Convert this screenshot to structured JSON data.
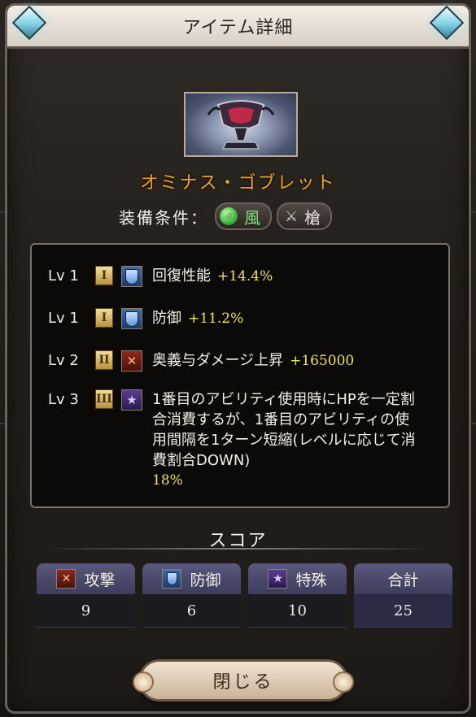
{
  "dialog": {
    "title": "アイテム詳細",
    "close_label": "閉じる"
  },
  "item": {
    "name": "オミナス・ゴブレット",
    "equip_label": "装備条件：",
    "element": "風",
    "weapon_type": "槍",
    "image_icon": "goblet-icon"
  },
  "skills": [
    {
      "level": "Lv 1",
      "rank": "I",
      "type_icon": "defense-shield-icon",
      "name": "回復性能",
      "value": "+14.4%"
    },
    {
      "level": "Lv 1",
      "rank": "I",
      "type_icon": "defense-shield-icon",
      "name": "防御",
      "value": "+11.2%"
    },
    {
      "level": "Lv 2",
      "rank": "II",
      "type_icon": "attack-swords-icon",
      "name": "奥義与ダメージ上昇",
      "value": "+165000"
    },
    {
      "level": "Lv 3",
      "rank": "III",
      "type_icon": "special-star-icon",
      "description": "1番目のアビリティ使用時にHPを一定割合消費するが、1番目のアビリティの使用間隔を1ターン短縮(レベルに応じて消費割合DOWN)",
      "value": "18%"
    }
  ],
  "score": {
    "title": "スコア",
    "columns": [
      {
        "label": "攻撃",
        "icon": "attack-swords-icon",
        "value": "9"
      },
      {
        "label": "防御",
        "icon": "defense-shield-icon",
        "value": "6"
      },
      {
        "label": "特殊",
        "icon": "special-star-icon",
        "value": "10"
      },
      {
        "label": "合計",
        "icon": "",
        "value": "25"
      }
    ]
  },
  "colors": {
    "item_name": "#f0a020",
    "value_yellow": "#ede35f",
    "wind_green": "#7be07a",
    "header_purple": "#5a587c"
  }
}
